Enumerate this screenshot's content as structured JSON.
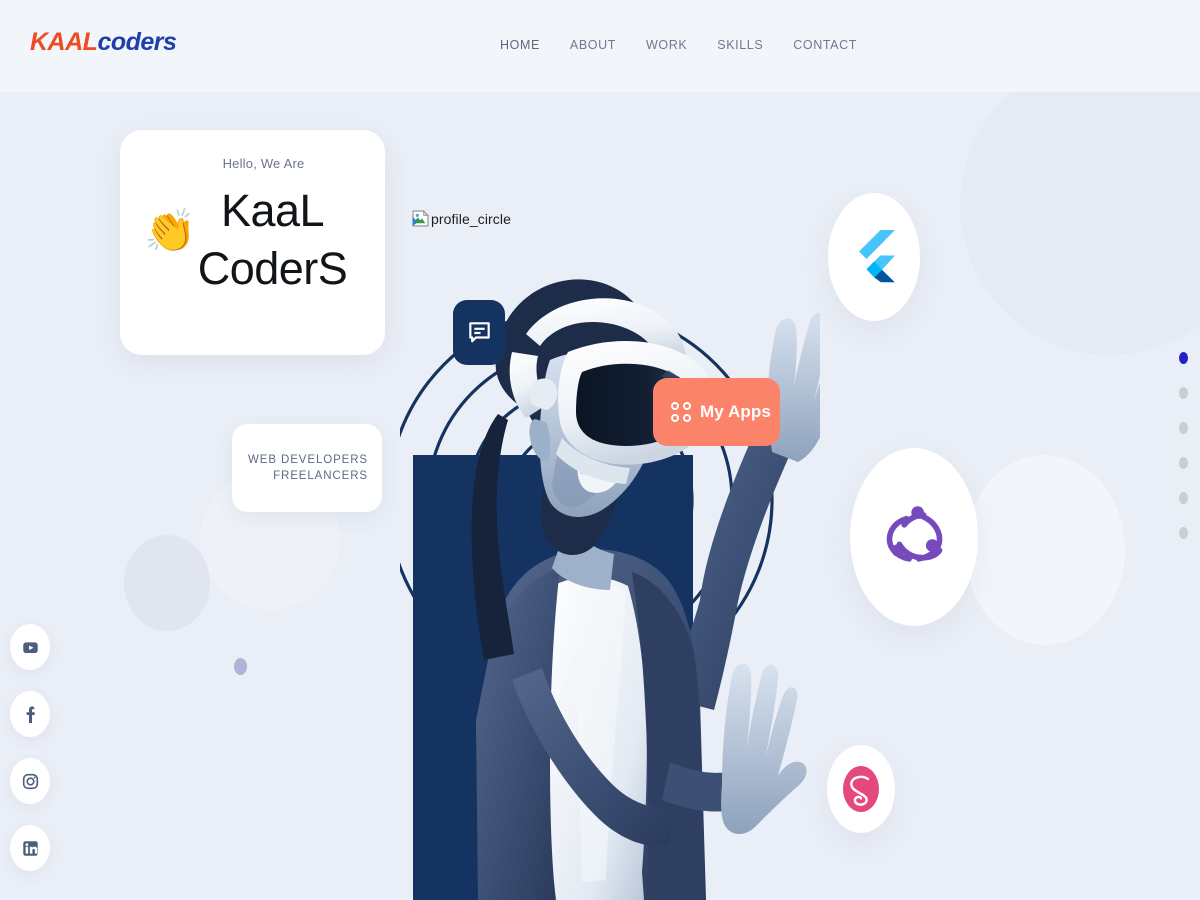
{
  "meta": {
    "page_background": "#eaeef6",
    "header_background": "#f2f5f9",
    "accent_coral": "#fa8369",
    "accent_navy": "#143361",
    "accent_blue": "#2222c4"
  },
  "header": {
    "logo": {
      "part1": "KAAL",
      "part1_color": "#f04a23",
      "part2": "coders",
      "part2_color": "#1f3fa8"
    },
    "nav": [
      {
        "label": "HOME",
        "active": true
      },
      {
        "label": "ABOUT",
        "active": false
      },
      {
        "label": "WORK",
        "active": false
      },
      {
        "label": "SKILLS",
        "active": false
      },
      {
        "label": "CONTACT",
        "active": false
      }
    ]
  },
  "hero": {
    "greeting": "Hello, We Are",
    "wave_emoji": "👏",
    "title_line1": "KaaL",
    "title_line2": "CoderS",
    "role_line1": "WEB DEVELOPERS",
    "role_line2": "FREELANCERS"
  },
  "broken_image": {
    "alt_text": "profile_circle"
  },
  "chips": {
    "chat_icon": "chat-bubble-icon",
    "apps_label": "My Apps",
    "apps_icon": "grid-dots-icon"
  },
  "tech_bubbles": [
    {
      "name": "flutter",
      "label": "Flutter",
      "color": "#45d1fd"
    },
    {
      "name": "redux",
      "label": "Redux",
      "color": "#764abc"
    },
    {
      "name": "sass",
      "label": "Sass",
      "color": "#e5487f"
    }
  ],
  "social": [
    {
      "name": "youtube",
      "label": "YouTube"
    },
    {
      "name": "facebook",
      "label": "Facebook"
    },
    {
      "name": "instagram",
      "label": "Instagram"
    },
    {
      "name": "linkedin",
      "label": "LinkedIn"
    }
  ],
  "pagination": {
    "total": 6,
    "active_index": 0
  }
}
